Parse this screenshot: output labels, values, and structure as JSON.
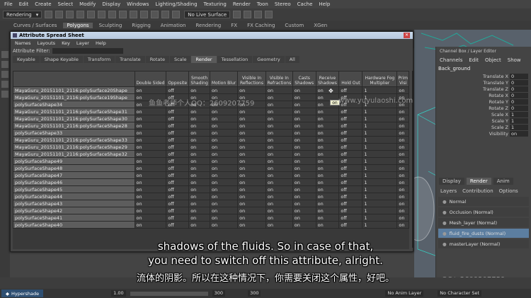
{
  "menubar": {
    "items": [
      "File",
      "Edit",
      "Create",
      "Select",
      "Modify",
      "Display",
      "Windows",
      "Lighting/Shading",
      "Texturing",
      "Render",
      "Toon",
      "Stereo",
      "Cache",
      "Help"
    ]
  },
  "shelf_row": {
    "mode": "Rendering",
    "live_surface": "No Live Surface"
  },
  "shelf_tabs": {
    "items": [
      "Curves / Surfaces",
      "Polygons",
      "Sculpting",
      "Rigging",
      "Animation",
      "Rendering",
      "FX",
      "FX Caching",
      "Custom",
      "XGen"
    ],
    "active": 1
  },
  "channel_box": {
    "header": "Channel Box / Layer Editor",
    "menu": [
      "Channels",
      "Edit",
      "Object",
      "Show"
    ],
    "object": "Back_ground",
    "attrs": [
      {
        "name": "Translate X",
        "value": "0"
      },
      {
        "name": "Translate Y",
        "value": "0"
      },
      {
        "name": "Translate Z",
        "value": "0"
      },
      {
        "name": "Rotate X",
        "value": "0"
      },
      {
        "name": "Rotate Y",
        "value": "0"
      },
      {
        "name": "Rotate Z",
        "value": "0"
      },
      {
        "name": "Scale X",
        "value": "1"
      },
      {
        "name": "Scale Y",
        "value": "1"
      },
      {
        "name": "Scale Z",
        "value": "1"
      },
      {
        "name": "Visibility",
        "value": "on"
      }
    ]
  },
  "layers": {
    "tabs": [
      "Display",
      "Render",
      "Anim"
    ],
    "active": 1,
    "menu": [
      "Layers",
      "Contribution",
      "Options"
    ],
    "rows": [
      {
        "label": "Normal"
      },
      {
        "label": "Occlusion (Normal)"
      },
      {
        "label": "Mesh_layer (Normal)"
      },
      {
        "label": "fluid_fire_dusts (Normal)"
      },
      {
        "label": "masterLayer (Normal)"
      }
    ]
  },
  "sheet": {
    "title": "Attribute Spread Sheet",
    "menu": [
      "Names",
      "Layouts",
      "Key",
      "Layer",
      "Help"
    ],
    "filter_label": "Attribute Filter:",
    "tabs": [
      "Keyable",
      "Shape Keyable",
      "Transform",
      "Translate",
      "Rotate",
      "Scale",
      "Render",
      "Tessellation",
      "Geometry",
      "All"
    ],
    "active_tab": 6,
    "columns": [
      "Double Sided",
      "Opposite",
      "Smooth Shading",
      "Motion Blur",
      "Visible In Reflections",
      "Visible In Refractions",
      "Casts Shadows",
      "Receive Shadows",
      "Hold Out",
      "Hardware Fog Multiplier",
      "Prim Visi"
    ],
    "rows": [
      {
        "name": "MayaGuru_20151101_2116:polySurface20Shape",
        "vals": [
          "on",
          "off",
          "on",
          "on",
          "on",
          "on",
          "on",
          "on",
          "off",
          "1",
          "on"
        ]
      },
      {
        "name": "MayaGuru_20151101_2116:polySurface19Shape",
        "vals": [
          "on",
          "off",
          "on",
          "on",
          "on",
          "on",
          "on",
          "on",
          "off",
          "1",
          "on"
        ]
      },
      {
        "name": "polySurfaceShape34",
        "vals": [
          "on",
          "off",
          "on",
          "on",
          "on",
          "on",
          "on",
          "on",
          "off",
          "1",
          "on"
        ]
      },
      {
        "name": "MayaGuru_20151101_2116:polySurfaceShape31",
        "vals": [
          "on",
          "off",
          "on",
          "on",
          "on",
          "on",
          "on",
          "on",
          "off",
          "1",
          "on"
        ]
      },
      {
        "name": "MayaGuru_20151101_2116:polySurfaceShape30",
        "vals": [
          "on",
          "off",
          "on",
          "on",
          "on",
          "on",
          "on",
          "on",
          "off",
          "1",
          "on"
        ]
      },
      {
        "name": "MayaGuru_20151101_2116:polySurfaceShape28",
        "vals": [
          "on",
          "off",
          "on",
          "on",
          "on",
          "on",
          "on",
          "on",
          "off",
          "1",
          "on"
        ]
      },
      {
        "name": "polySurfaceShape33",
        "vals": [
          "on",
          "off",
          "on",
          "on",
          "on",
          "on",
          "on",
          "on",
          "off",
          "1",
          "on"
        ]
      },
      {
        "name": "MayaGuru_20151101_2116:polySurfaceShape33",
        "vals": [
          "on",
          "off",
          "on",
          "on",
          "on",
          "on",
          "on",
          "on",
          "off",
          "1",
          "on"
        ]
      },
      {
        "name": "MayaGuru_20151101_2116:polySurfaceShape29",
        "vals": [
          "on",
          "off",
          "on",
          "on",
          "on",
          "on",
          "on",
          "on",
          "off",
          "1",
          "on"
        ]
      },
      {
        "name": "MayaGuru_20151101_2116:polySurfaceShape32",
        "vals": [
          "on",
          "off",
          "on",
          "on",
          "on",
          "on",
          "on",
          "on",
          "off",
          "1",
          "on"
        ]
      },
      {
        "name": "polySurfaceShape49",
        "vals": [
          "on",
          "off",
          "on",
          "on",
          "on",
          "on",
          "on",
          "on",
          "off",
          "1",
          "on"
        ]
      },
      {
        "name": "polySurfaceShape48",
        "vals": [
          "on",
          "off",
          "on",
          "on",
          "on",
          "on",
          "on",
          "on",
          "off",
          "1",
          "on"
        ]
      },
      {
        "name": "polySurfaceShape47",
        "vals": [
          "on",
          "off",
          "on",
          "on",
          "on",
          "on",
          "on",
          "on",
          "off",
          "1",
          "on"
        ]
      },
      {
        "name": "polySurfaceShape46",
        "vals": [
          "on",
          "off",
          "on",
          "on",
          "on",
          "on",
          "on",
          "on",
          "off",
          "1",
          "on"
        ]
      },
      {
        "name": "polySurfaceShape45",
        "vals": [
          "on",
          "off",
          "on",
          "on",
          "on",
          "on",
          "on",
          "on",
          "off",
          "1",
          "on"
        ]
      },
      {
        "name": "polySurfaceShape44",
        "vals": [
          "on",
          "off",
          "on",
          "on",
          "on",
          "on",
          "on",
          "on",
          "off",
          "1",
          "on"
        ]
      },
      {
        "name": "polySurfaceShape43",
        "vals": [
          "on",
          "off",
          "on",
          "on",
          "on",
          "on",
          "on",
          "on",
          "off",
          "1",
          "on"
        ]
      },
      {
        "name": "polySurfaceShape42",
        "vals": [
          "on",
          "off",
          "on",
          "on",
          "on",
          "on",
          "on",
          "on",
          "off",
          "1",
          "on"
        ]
      },
      {
        "name": "polySurfaceShape41",
        "vals": [
          "on",
          "off",
          "on",
          "on",
          "on",
          "on",
          "on",
          "on",
          "off",
          "1",
          "on"
        ]
      },
      {
        "name": "polySurfaceShape40",
        "vals": [
          "on",
          "off",
          "on",
          "on",
          "on",
          "on",
          "on",
          "on",
          "off",
          "1",
          "on"
        ]
      }
    ],
    "tooltip": "on"
  },
  "watermarks": {
    "qq": "鱼鱼老师个人QQ：2609207759",
    "site": "www.yuyulaoshi.com",
    "qq2": "QQ：2609207759"
  },
  "subtitles": {
    "line1": "shadows of the fluids. So in case of that,",
    "line2": "you need to switch off this attribute, alright.",
    "line3": "流体的阴影。所以在这种情况下，你需要关闭这个属性，好吧。"
  },
  "bottom": {
    "hypershade": "Hypershade",
    "field_a": "1.00",
    "field_b": "300",
    "field_c": "300",
    "anim_layer": "No Anim Layer",
    "char_set": "No Character Set"
  },
  "colors": {
    "accent": "#5c7ea0",
    "title_bar": "#c9d8ea"
  }
}
